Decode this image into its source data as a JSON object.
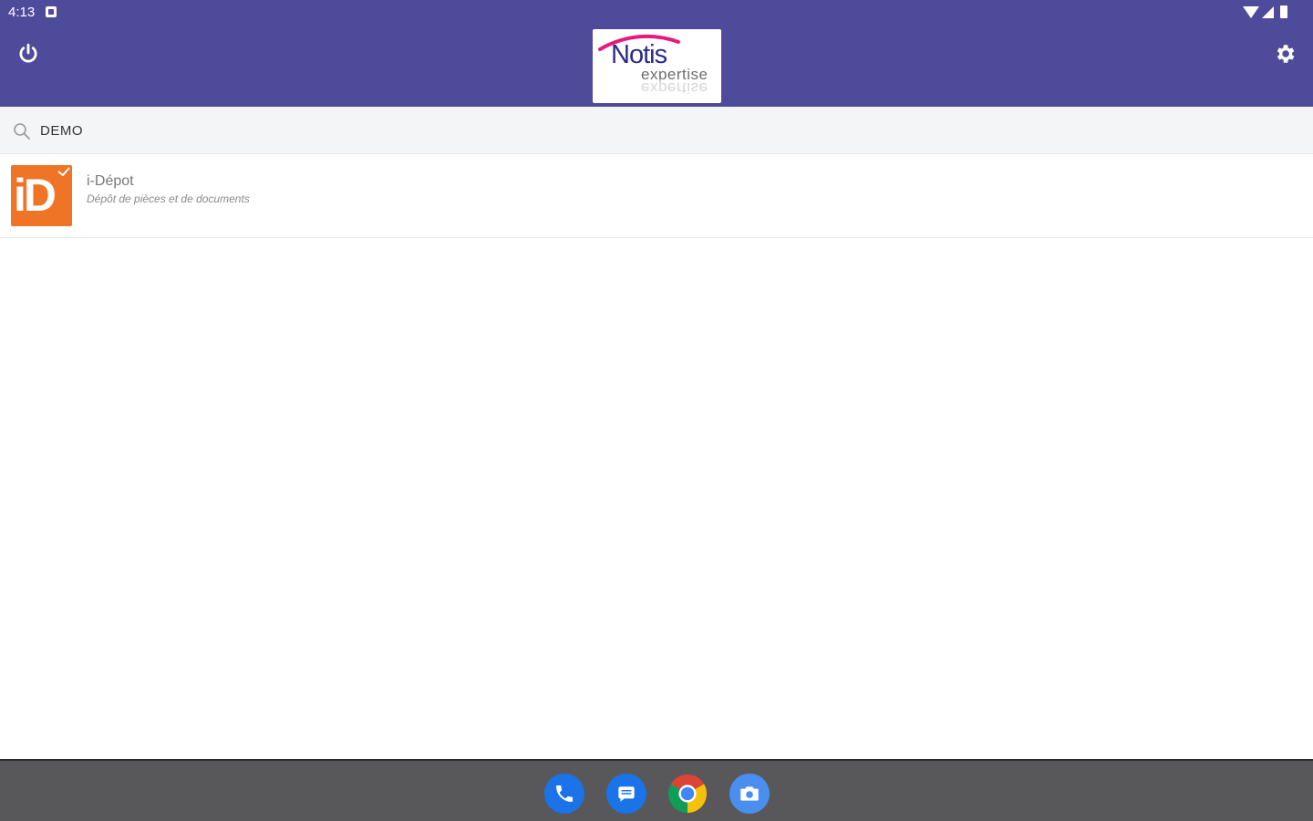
{
  "status_bar": {
    "time": "4:13"
  },
  "app_bar": {
    "logo_text_main": "Notis",
    "logo_text_sub": "expertise",
    "background_color": "#4e4b9b"
  },
  "search": {
    "value": "DEMO"
  },
  "list": {
    "items": [
      {
        "icon_text": "iD",
        "title": "i-Dépot",
        "subtitle": "Dépôt de pièces et de documents",
        "icon_color": "#f07426"
      }
    ]
  },
  "dock": {
    "apps": [
      "phone-icon",
      "messages-icon",
      "chrome-icon",
      "camera-icon"
    ]
  }
}
